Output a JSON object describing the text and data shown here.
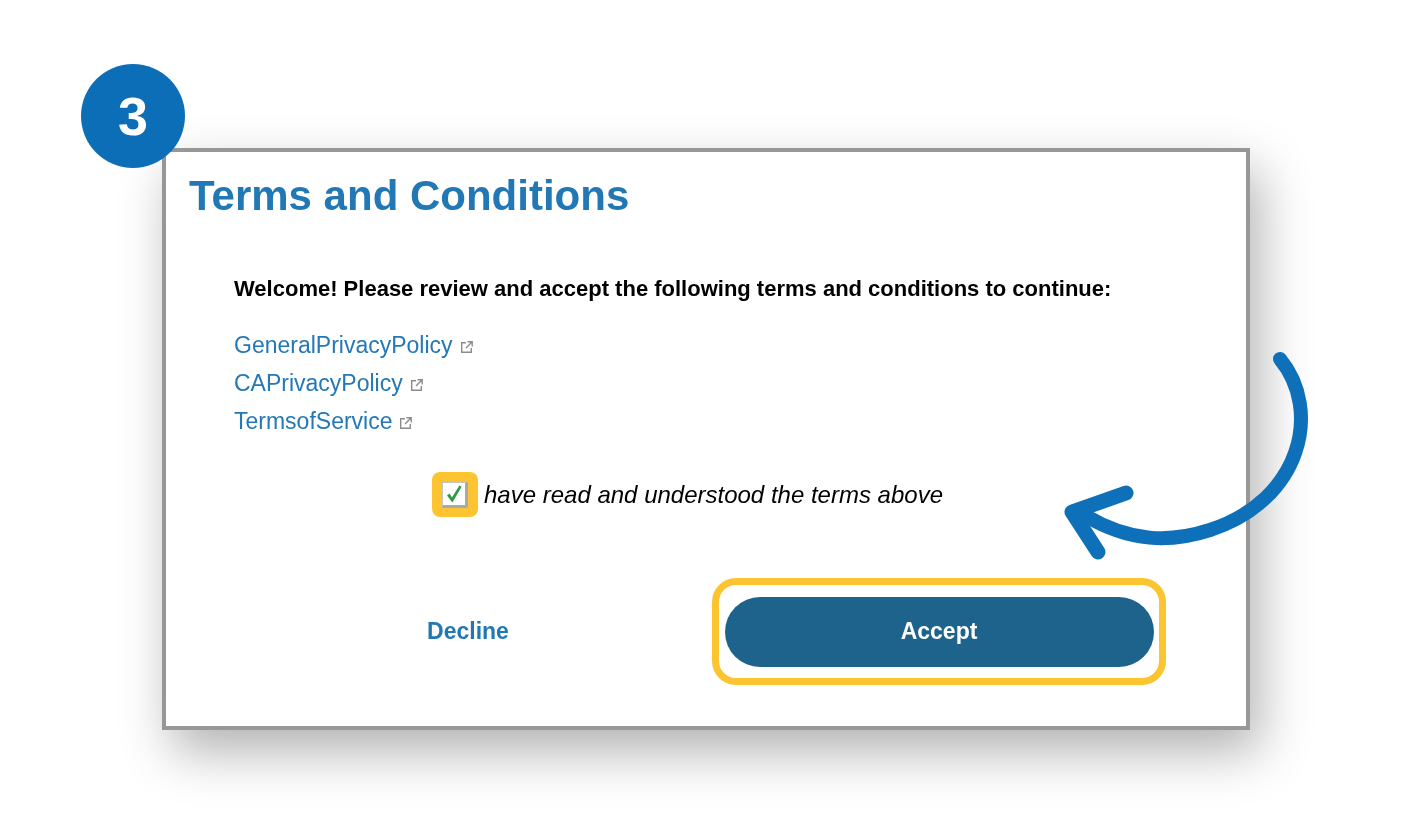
{
  "step_badge": "3",
  "dialog": {
    "title": "Terms and Conditions",
    "intro": "Welcome! Please review and accept the following terms and conditions to continue:",
    "links": [
      {
        "label": "GeneralPrivacyPolicy",
        "external": true
      },
      {
        "label": "CAPrivacyPolicy",
        "external": true
      },
      {
        "label": "TermsofService",
        "external": true
      }
    ],
    "agreement": {
      "label": "have read and understood the terms above",
      "checked": true,
      "highlighted": true
    },
    "buttons": [
      {
        "label": "Decline",
        "kind": "link",
        "highlighted": false
      },
      {
        "label": "Accept",
        "kind": "primary",
        "highlighted": true
      }
    ]
  }
}
